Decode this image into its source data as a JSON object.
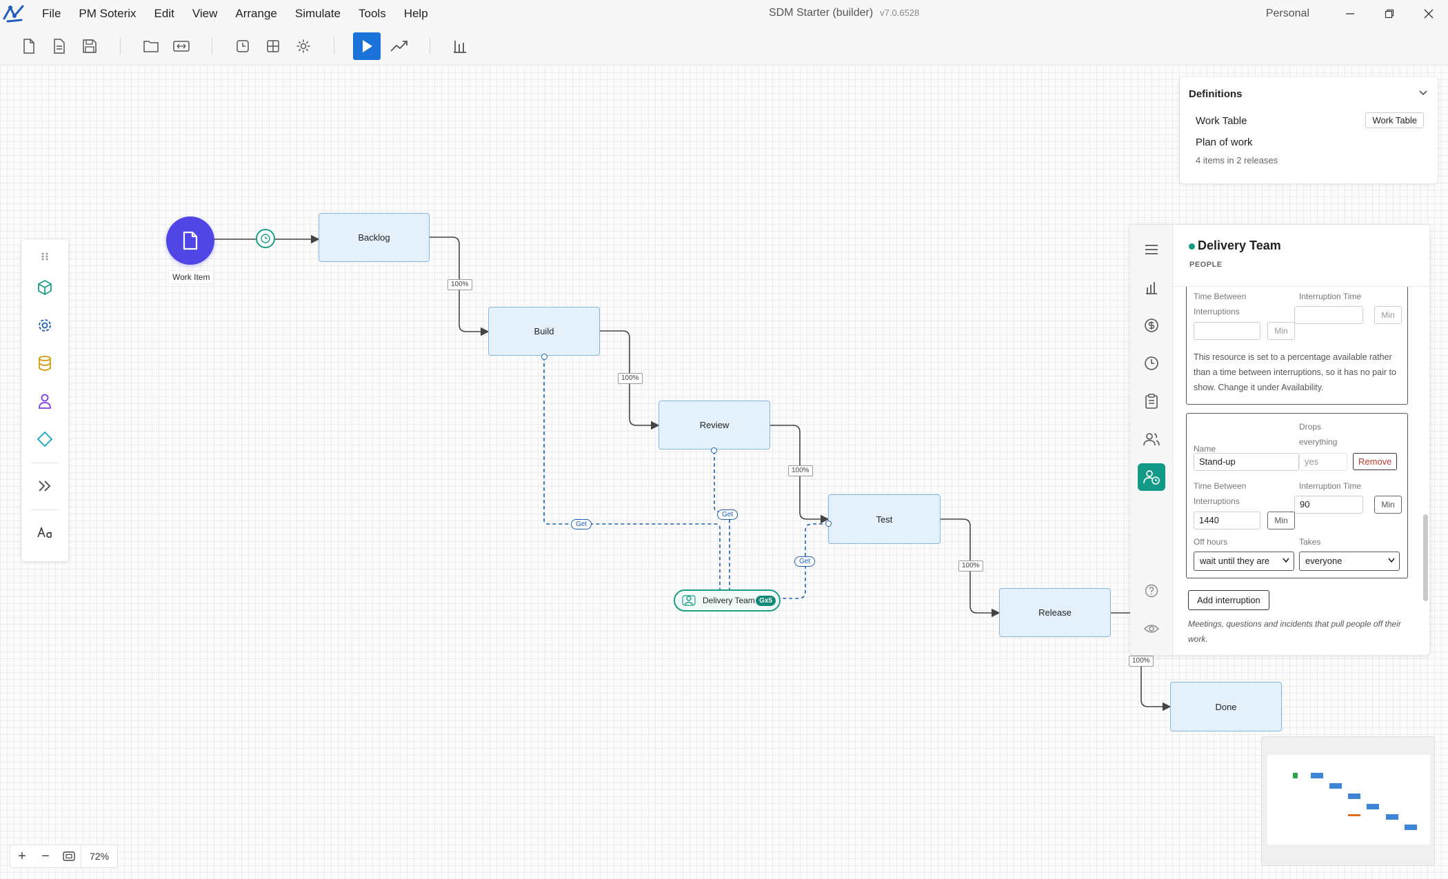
{
  "window": {
    "title": "SDM Starter (builder)",
    "version": "v7.0.6528",
    "account": "Personal"
  },
  "menu": [
    "File",
    "PM Soterix",
    "Edit",
    "View",
    "Arrange",
    "Simulate",
    "Tools",
    "Help"
  ],
  "toolbar": {
    "icons": [
      "new-file-icon",
      "new-document-icon",
      "save-icon",
      "open-folder-icon",
      "fit-width-icon",
      "timer-icon",
      "grid-icon",
      "settings-icon",
      "play-icon",
      "trend-icon",
      "bar-chart-icon"
    ],
    "accent": "#1a73d9"
  },
  "palette": {
    "items": [
      "cube-icon",
      "gear-icon",
      "database-icon",
      "person-icon",
      "decision-diamond-icon",
      "double-chevron-right-icon",
      "text-style-icon"
    ]
  },
  "diagram": {
    "start": {
      "label": "Work Item",
      "color": "#4f46e5"
    },
    "nodes": [
      "Backlog",
      "Build",
      "Review",
      "Test",
      "Release",
      "Done"
    ],
    "edge_labels": [
      "100%",
      "100%",
      "100%",
      "100%",
      "100%"
    ],
    "get_labels": [
      "Get",
      "Get",
      "Get"
    ],
    "resource": {
      "label": "Delivery Team",
      "badge": "Gx5",
      "color": "#1a9e88"
    }
  },
  "definitions": {
    "title": "Definitions",
    "work_table_label": "Work Table",
    "work_table_button": "Work Table",
    "plan_title": "Plan of work",
    "plan_subtitle": "4 items in 2 releases"
  },
  "panel": {
    "title": "Delivery Team",
    "kind": "PEOPLE",
    "status_color": "#139a86",
    "rail": [
      "menu-icon",
      "chart-icon",
      "dollar-icon",
      "clock-icon",
      "clipboard-icon",
      "people-icon",
      "person-clock-icon",
      "help-icon",
      "eye-icon"
    ],
    "interruption1": {
      "tbi_label": "Time Between Interruptions",
      "it_label": "Interruption Time",
      "tbi_value": "",
      "it_value": "",
      "unit": "Min",
      "note": "This resource is set to a percentage available rather than a time between interruptions, so it has no pair to show. Change it under Availability."
    },
    "interruption2": {
      "name_label": "Name",
      "name_value": "Stand-up",
      "drops_label": "Drops everything",
      "drops_value": "yes",
      "remove": "Remove",
      "tbi_label": "Time Between Interruptions",
      "tbi_value": "1440",
      "it_label": "Interruption Time",
      "it_value": "90",
      "unit": "Min",
      "off_hours_label": "Off hours",
      "off_hours_value": "wait until they are",
      "takes_label": "Takes",
      "takes_value": "everyone"
    },
    "add_button": "Add interruption",
    "help": "Meetings, questions and incidents that pull people off their work."
  },
  "zoom": {
    "value": "72%"
  }
}
